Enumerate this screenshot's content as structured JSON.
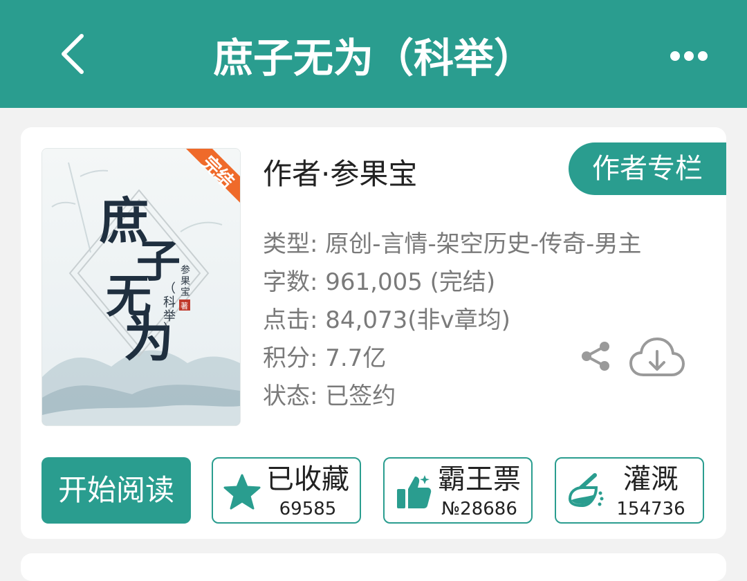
{
  "header": {
    "title": "庶子无为（科举）",
    "back_icon": "chevron-left-icon",
    "more_icon": "more-dots-icon",
    "color": "#2a9d8f"
  },
  "book": {
    "cover": {
      "title_art": "庶子无为",
      "subtitle": "（科举）",
      "author_signature": "参果宝著",
      "status_ribbon": "完结"
    },
    "author_line": "作者·参果宝",
    "author_column_button": "作者专栏",
    "info": [
      "类型: 原创-言情-架空历史-传奇-男主",
      "字数: 961,005 (完结)",
      "点击: 84,073(非v章均)",
      "积分: 7.7亿",
      "状态: 已签约"
    ],
    "share_icon": "share-icon",
    "download_icon": "cloud-download-icon"
  },
  "actions": {
    "read_button": "开始阅读",
    "collect": {
      "label": "已收藏",
      "count": "69585",
      "icon": "star-icon"
    },
    "vote": {
      "label": "霸王票",
      "count": "№28686",
      "icon": "thumbs-up-icon"
    },
    "nutrient": {
      "label": "灌溉",
      "count": "154736",
      "icon": "watering-flask-icon"
    }
  },
  "colors": {
    "accent": "#2a9d8f",
    "ribbon": "#ef6a2a",
    "gray": "#7a7a7a"
  }
}
